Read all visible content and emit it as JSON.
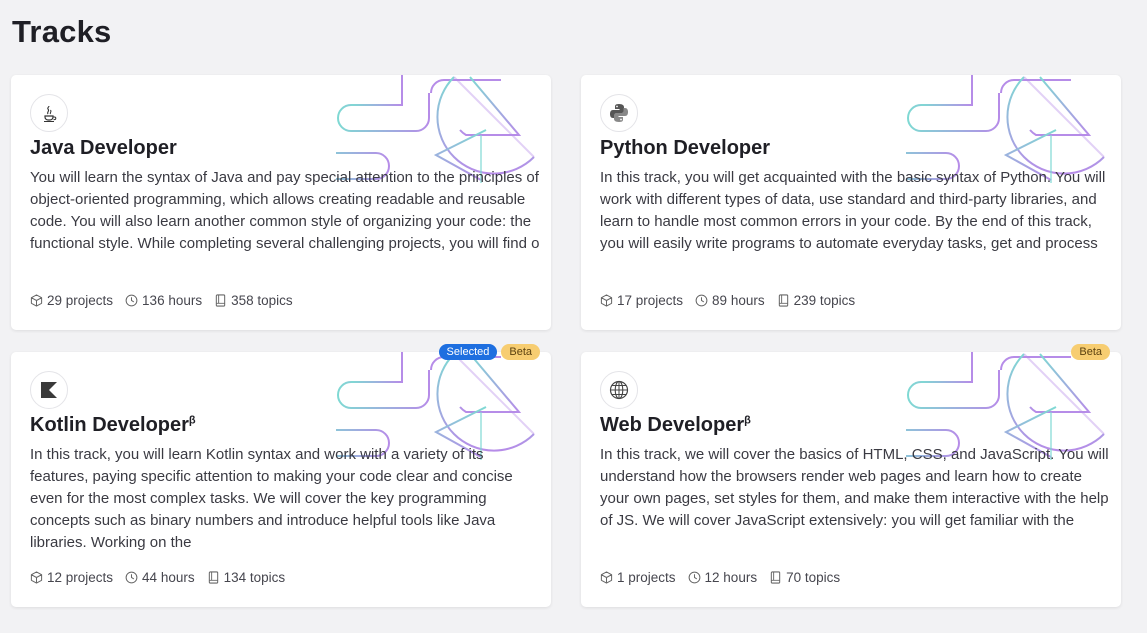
{
  "page": {
    "title": "Tracks"
  },
  "tracks": [
    {
      "name": "Java Developer",
      "beta": false,
      "icon": "java-icon",
      "description": "You will learn the syntax of Java and pay special attention to the principles of object-oriented programming, which allows creating readable and reusable code. You will also learn another common style of organizing your code: the functional style. While completing several challenging projects, you will find o",
      "projects": "29 projects",
      "hours": "136 hours",
      "topics": "358 topics",
      "badges": []
    },
    {
      "name": "Python Developer",
      "beta": false,
      "icon": "python-icon",
      "description": "In this track, you will get acquainted with the basic syntax of Python. You will work with different types of data, use standard and third-party libraries, and learn to handle most common errors in your code. By the end of this track, you will easily write programs to automate everyday tasks, get and process",
      "projects": "17 projects",
      "hours": "89 hours",
      "topics": "239 topics",
      "badges": []
    },
    {
      "name": "Kotlin Developer",
      "beta": true,
      "beta_mark": "β",
      "icon": "kotlin-icon",
      "description": "In this track, you will learn Kotlin syntax and work with a variety of its features, paying specific attention to making your code clear and concise even for the most complex tasks. We will cover the key programming concepts such as binary numbers and introduce helpful tools like Java libraries. Working on the",
      "projects": "12 projects",
      "hours": "44 hours",
      "topics": "134 topics",
      "badges": [
        "Selected",
        "Beta"
      ]
    },
    {
      "name": "Web Developer",
      "beta": true,
      "beta_mark": "β",
      "icon": "globe-icon",
      "description": "In this track, we will cover the basics of HTML, CSS, and JavaScript. You will understand how the browsers render web pages and learn how to create your own pages, set styles for them, and make them interactive with the help of JS. We will cover JavaScript extensively: you will get familiar with the",
      "projects": "1 projects",
      "hours": "12 hours",
      "topics": "70 topics",
      "badges": [
        "Beta"
      ]
    }
  ],
  "icons": {
    "projects": "cube-icon",
    "hours": "clock-icon",
    "topics": "book-icon"
  },
  "colors": {
    "selected_badge": "#1e6fe0",
    "beta_badge": "#f7cd71",
    "deco_teal": "#7fd9d3",
    "deco_purple": "#b68ce8"
  }
}
